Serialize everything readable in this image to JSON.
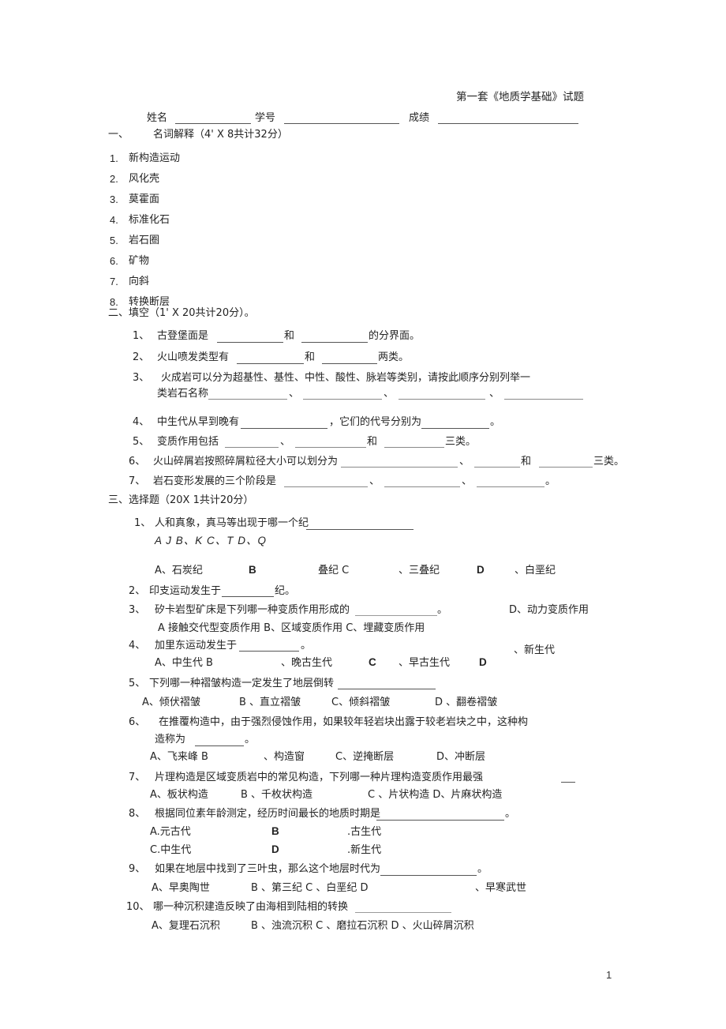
{
  "document": {
    "title": "第一套《地质学基础》试题",
    "page_number": "1",
    "identity_line": {
      "name_label": "姓名",
      "student_id_label": "学号",
      "score_label": "成绩"
    }
  },
  "section_one": {
    "number": "一、",
    "heading": "名词解释（4' X 8共计32分）",
    "items": [
      {
        "num": "1.",
        "text": "新构造运动"
      },
      {
        "num": "2.",
        "text": "风化壳"
      },
      {
        "num": "3.",
        "text": "莫霍面"
      },
      {
        "num": "4.",
        "text": "标准化石"
      },
      {
        "num": "5.",
        "text": "岩石圈"
      },
      {
        "num": "6.",
        "text": "矿物"
      },
      {
        "num": "7.",
        "text": "向斜"
      },
      {
        "num": "8.",
        "text": "转换断层"
      }
    ]
  },
  "section_two": {
    "heading": "二、填空（1' X 20共计20分）。",
    "q1": {
      "num": "1、",
      "pre": "古登堡面是",
      "mid": "和",
      "post": "的分界面。"
    },
    "q2": {
      "num": "2、",
      "pre": "火山喷发类型有",
      "mid": "和",
      "post": "两类。"
    },
    "q3": {
      "num": "3、",
      "line1": "火成岩可以分为超基性、基性、中性、酸性、脉岩等类别，请按此顺序分别列举一",
      "line2_pre": "类岩石名称",
      "sep": "、"
    },
    "q4": {
      "num": "4、",
      "pre": "中生代从早到晚有",
      "mid": "，它们的代号分别为",
      "post": "。"
    },
    "q5": {
      "num": "5、",
      "pre": "变质作用包括",
      "sep": "、",
      "mid": "和",
      "post": "三类。"
    },
    "q6": {
      "num": "6、",
      "pre": "火山碎屑岩按照碎屑粒径大小可以划分为",
      "sep": "、",
      "mid": "和",
      "post": "三类。"
    },
    "q7": {
      "num": "7、",
      "pre": "岩石变形发展的三个阶段是",
      "sep1": "、",
      "sep2": "、",
      "post": "。"
    }
  },
  "section_three": {
    "heading": "三、选择题（20X 1共计20分）",
    "questions": [
      {
        "num": "1、",
        "stem": "人和真象，真马等出现于哪一个纪",
        "codeline": "A J B、K C、T D、Q",
        "options_row": [
          {
            "label": "A、石炭纪"
          },
          {
            "label": "B"
          },
          {
            "label": "叠纪 C"
          },
          {
            "label": "、三叠纪"
          },
          {
            "label": "D"
          },
          {
            "label": "、白垩纪"
          }
        ]
      },
      {
        "num": "2、",
        "stem_pre": "印支运动发生于",
        "stem_post": "纪。"
      },
      {
        "num": "3、",
        "stem": "矽卡岩型矿床是下列哪一种变质作用形成的",
        "stem_tail": "。",
        "options_line": "A 接触交代型变质作用 B、区域变质作用 C、埋藏变质作用",
        "option_right": "D、动力变质作用"
      },
      {
        "num": "4、",
        "stem_pre": "加里东运动发生于",
        "stem_post": "。",
        "options_row": [
          {
            "label": "A、中生代 B"
          },
          {
            "label": "、晚古生代"
          },
          {
            "label": "C"
          },
          {
            "label": "、早古生代"
          },
          {
            "label": "D"
          }
        ],
        "option_right": "、新生代"
      },
      {
        "num": "5、",
        "stem": "下列哪一种褶皱构造一定发生了地层倒转",
        "options_row": [
          {
            "label": "A、倾伏褶皱"
          },
          {
            "label": "B 、直立褶皱"
          },
          {
            "label": "C、倾斜褶皱"
          },
          {
            "label": "D 、翻卷褶皱"
          }
        ]
      },
      {
        "num": "6、",
        "line1": "在推覆构造中，由于强烈侵蚀作用，如果较年轻岩块出露于较老岩块之中，这种构",
        "line2_pre": "造称为",
        "line2_post": "。",
        "options_row": [
          {
            "label": "A、飞来峰 B"
          },
          {
            "label": "、构造窗"
          },
          {
            "label": "C、逆掩断层"
          },
          {
            "label": "D、冲断层"
          }
        ]
      },
      {
        "num": "7、",
        "stem": "片理构造是区域变质岩中的常见构造，下列哪一种片理构造变质作用最强",
        "options_row": [
          {
            "label": "A、板状构造"
          },
          {
            "label": "B 、千枚状构造"
          },
          {
            "label": "C 、片状构造 D、片麻状构造"
          }
        ]
      },
      {
        "num": "8、",
        "stem": "根据同位素年龄测定，经历时间最长的地质时期是",
        "stem_tail": "。",
        "options_grid": [
          {
            "label": "A.元古代"
          },
          {
            "label": "B"
          },
          {
            "label": ".古生代"
          },
          {
            "label": "C.中生代"
          },
          {
            "label": "D"
          },
          {
            "label": ".新生代"
          }
        ]
      },
      {
        "num": "9、",
        "stem": "如果在地层中找到了三叶虫，那么这个地层时代为",
        "stem_tail": "。",
        "options_row": [
          {
            "label": "A、早奥陶世"
          },
          {
            "label": "B 、第三纪 C 、白垩纪 D"
          },
          {
            "label": "、早寒武世"
          }
        ]
      },
      {
        "num": "10、",
        "stem": "哪一种沉积建造反映了由海相到陆相的转换",
        "options_row": [
          {
            "label": "A、复理石沉积"
          },
          {
            "label": "B 、浊流沉积 C 、磨拉石沉积 D 、火山碎屑沉积"
          }
        ]
      }
    ]
  }
}
